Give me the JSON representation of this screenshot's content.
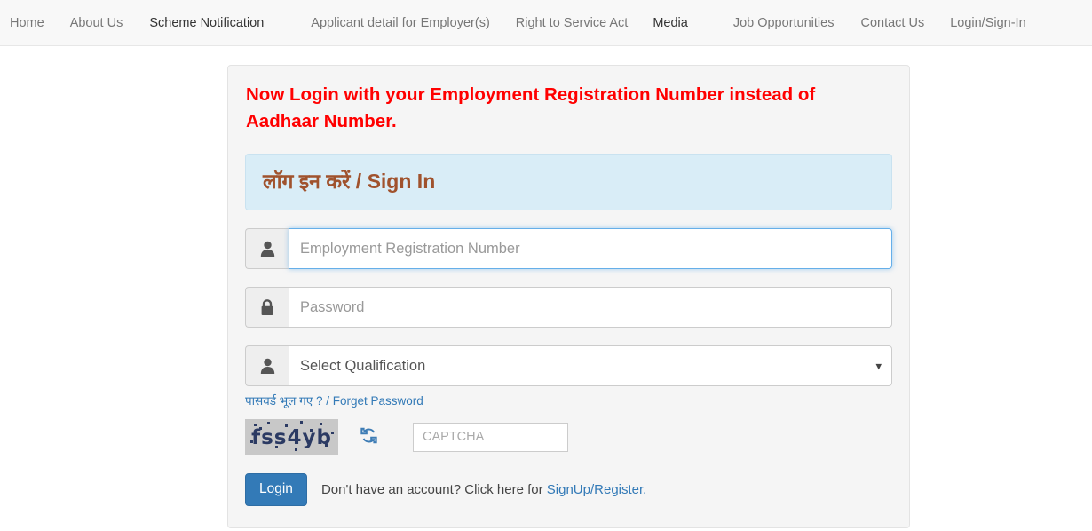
{
  "nav": {
    "items": [
      {
        "label": "Home",
        "active": false,
        "name": "nav-item-home"
      },
      {
        "label": "About Us",
        "active": false,
        "name": "nav-item-about-us"
      },
      {
        "label": "Scheme Notification",
        "active": true,
        "name": "nav-item-scheme-notification"
      },
      {
        "label": "Applicant detail for Employer(s)",
        "active": false,
        "name": "nav-item-applicant-detail"
      },
      {
        "label": "Right to Service Act",
        "active": false,
        "name": "nav-item-right-to-service-act"
      },
      {
        "label": "Media",
        "active": true,
        "name": "nav-item-media"
      },
      {
        "label": "Job Opportunities",
        "active": false,
        "name": "nav-item-job-opportunities"
      },
      {
        "label": "Contact Us",
        "active": false,
        "name": "nav-item-contact-us"
      },
      {
        "label": "Login/Sign-In",
        "active": false,
        "name": "nav-item-login-signin"
      }
    ]
  },
  "panel": {
    "alert": "Now Login with your Employment Registration Number instead of Aadhaar Number.",
    "signin_header": "लॉग इन करें / Sign In",
    "fields": {
      "registration": {
        "placeholder": "Employment Registration Number",
        "value": "",
        "icon": "user-icon",
        "focused": true
      },
      "password": {
        "placeholder": "Password",
        "value": "",
        "icon": "lock-icon",
        "focused": false
      },
      "qualification": {
        "selected": "Select Qualification",
        "icon": "user-icon",
        "options": [
          "Select Qualification"
        ]
      },
      "captcha_input": {
        "placeholder": "CAPTCHA",
        "value": ""
      }
    },
    "forget_password": "पासवर्ड भूल गए ? / Forget Password",
    "captcha": {
      "text": "fss4yb",
      "refresh_icon": "refresh-icon"
    },
    "login_button": "Login",
    "signup_prompt": "Don't have an account? Click here for ",
    "signup_link": "SignUp/Register.",
    "colors": {
      "alert_red": "#ff0000",
      "signin_bg": "#d9edf7",
      "signin_text": "#a0522d",
      "primary_blue": "#337ab7",
      "panel_bg": "#f5f5f5",
      "captcha_bg": "#c8c8c8",
      "captcha_text": "#2b3a63"
    }
  }
}
